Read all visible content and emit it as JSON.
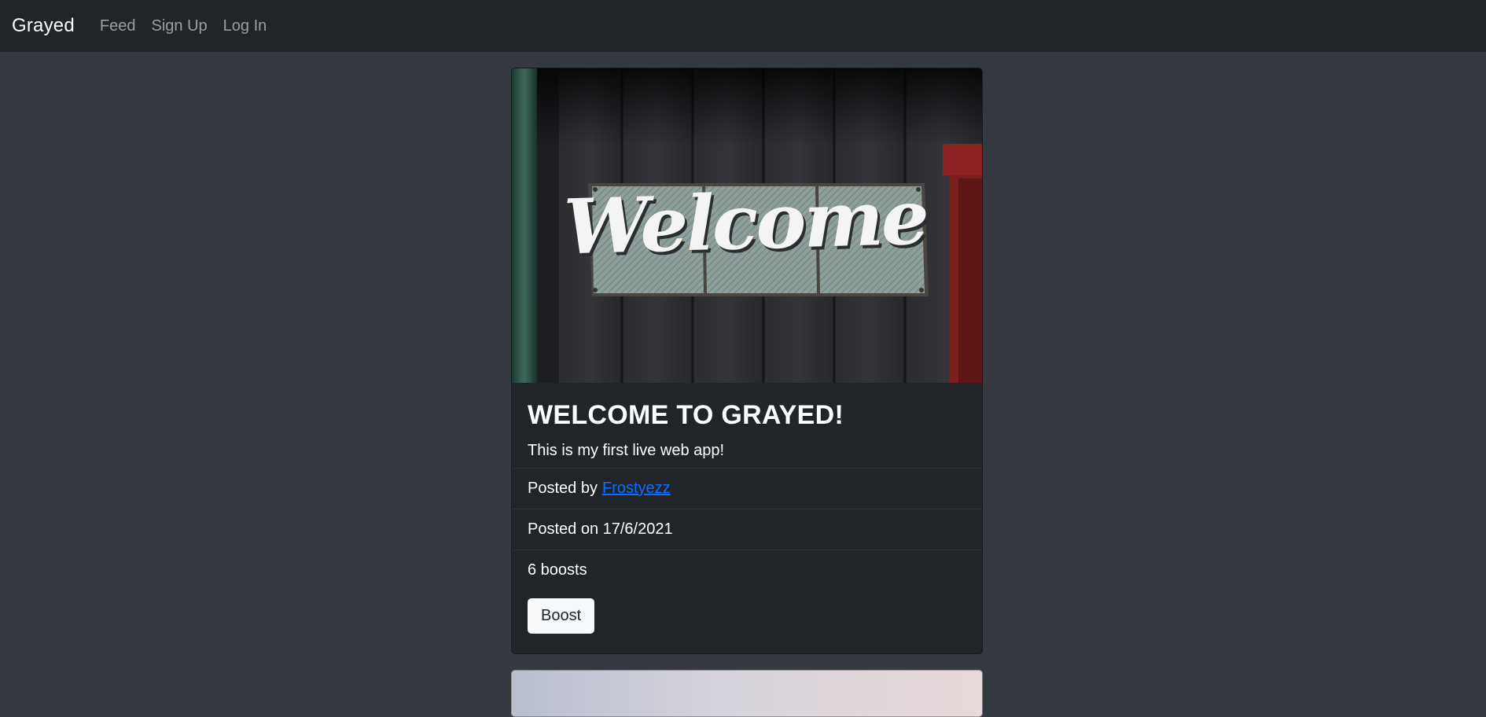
{
  "navbar": {
    "brand": "Grayed",
    "links": [
      "Feed",
      "Sign Up",
      "Log In"
    ]
  },
  "post": {
    "image_text": "Welcome",
    "title": "WELCOME TO GRAYED!",
    "body": "This is my first live web app!",
    "posted_by_label": "Posted by",
    "author": "Frostyezz",
    "posted_on": "Posted on 17/6/2021",
    "boosts": "6 boosts",
    "boost_button": "Boost"
  },
  "colors": {
    "navbar_bg": "#212529",
    "page_bg": "#343a40",
    "card_bg": "#212529",
    "link": "#0d6efd"
  }
}
